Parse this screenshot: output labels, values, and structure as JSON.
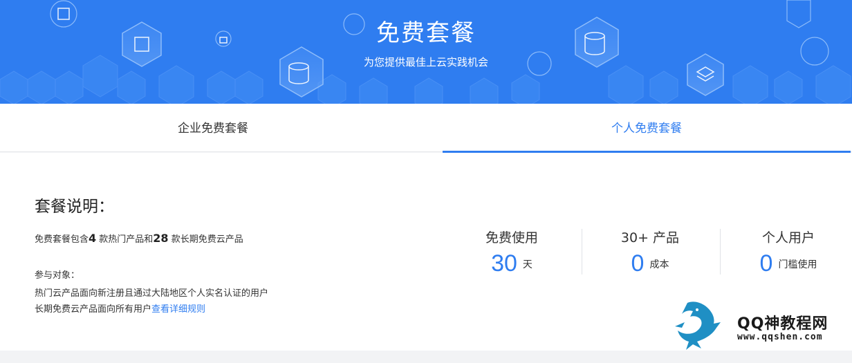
{
  "banner": {
    "title": "免费套餐",
    "subtitle": "为您提供最佳上云实践机会"
  },
  "tabs": [
    {
      "label": "企业免费套餐",
      "active": false
    },
    {
      "label": "个人免费套餐",
      "active": true
    }
  ],
  "description": {
    "title": "套餐说明：",
    "line1": {
      "prefix": "免费套餐包含",
      "hot_count": "4",
      "mid": " 款热门产品和",
      "long_count": "28",
      "suffix": " 款长期免费云产品"
    },
    "target_label": "参与对象：",
    "hot_target": "热门云产品面向新注册且通过大陆地区个人实名认证的用户",
    "long_target_prefix": "长期免费云产品面向所有用户",
    "rules_link": "查看详细规则"
  },
  "stats": [
    {
      "head": "免费使用",
      "num": "30",
      "unit": "天"
    },
    {
      "head": "30+ 产品",
      "num": "0",
      "unit": "成本"
    },
    {
      "head": "个人用户",
      "num": "0",
      "unit": "门槛使用"
    }
  ],
  "watermark": {
    "name": "QQ神教程网",
    "url": "www.qqshen.com"
  },
  "colors": {
    "accent": "#2f7df0",
    "banner_bg": "#2f7df0"
  }
}
